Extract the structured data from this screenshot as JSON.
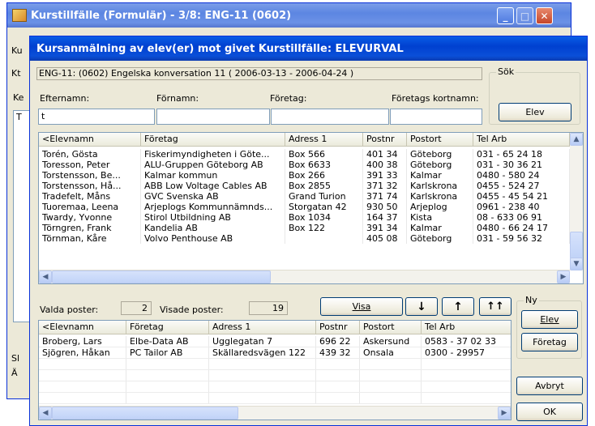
{
  "back_window": {
    "title": "Kurstillfälle (Formulär) - 3/8: ENG-11 (0602)",
    "left_labels": [
      "Ku",
      "Kt",
      "Ke",
      "T",
      "Sl",
      "Ä"
    ]
  },
  "dialog": {
    "title": "Kursanmälning av elev(er) mot givet Kurstillfälle: ELEVURVAL",
    "course_info": "ENG-11: (0602) Engelska konversation 11 ( 2006-03-13 - 2006-04-24 )",
    "sok_label": "Sök",
    "sok_elev_button": "Elev",
    "filter_labels": {
      "efternamn": "Efternamn:",
      "fornamn": "Förnamn:",
      "foretag": "Företag:",
      "kortnamn": "Företags kortnamn:"
    },
    "filter_values": {
      "efternamn": "t",
      "fornamn": "",
      "foretag": "",
      "kortnamn": ""
    },
    "top_grid": {
      "columns": [
        "<Elevnamn",
        "Företag",
        "Adress 1",
        "Postnr",
        "Postort",
        "Tel Arb"
      ],
      "rows": [
        [
          "Torén, Gösta",
          "Fiskerimyndigheten i Göte...",
          "Box 566",
          "401 34",
          "Göteborg",
          "031 - 65 24 18"
        ],
        [
          "Toresson, Peter",
          "ALU-Gruppen Göteborg AB",
          "Box 6633",
          "400 38",
          "Göteborg",
          "031 - 30 36 21"
        ],
        [
          "Torstensson, Be...",
          "Kalmar kommun",
          "Box 266",
          "391 33",
          "Kalmar",
          "0480 - 580 24"
        ],
        [
          "Torstensson, Hå...",
          "ABB Low Voltage Cables AB",
          "Box 2855",
          "371 32",
          "Karlskrona",
          "0455 - 524 27"
        ],
        [
          "Tradefelt, Måns",
          "GVC Svenska AB",
          "Grand Turion",
          "371 74",
          "Karlskrona",
          "0455 - 45 54 21"
        ],
        [
          "Tuoremaa, Leena",
          "Arjeplogs Kommunnämnds...",
          "Storgatan 42",
          "930 50",
          "Arjeplog",
          "0961 - 238 40"
        ],
        [
          "Twardy, Yvonne",
          "Stirol Utbildning AB",
          "Box 1034",
          "164 37",
          "Kista",
          "08 - 633 06 91"
        ],
        [
          "Törngren, Frank",
          "Kandelia AB",
          "Box 122",
          "391 34",
          "Kalmar",
          "0480 - 66 24 17"
        ],
        [
          "Törnman, Kåre",
          "Volvo Penthouse AB",
          "",
          "405 08",
          "Göteborg",
          "031 - 59 56 32"
        ]
      ]
    },
    "status": {
      "valda_label": "Valda poster:",
      "valda_value": "2",
      "visade_label": "Visade poster:",
      "visade_value": "19",
      "visa_button": "Visa",
      "down_arrow": "↓",
      "up_arrow": "↑",
      "double_up": "↑↑"
    },
    "bottom_grid": {
      "columns": [
        "<Elevnamn",
        "Företag",
        "Adress 1",
        "Postnr",
        "Postort",
        "Tel Arb"
      ],
      "rows": [
        [
          "Broberg, Lars",
          "Elbe-Data AB",
          "Ugglegatan 7",
          "696 22",
          "Askersund",
          "0583 - 37 02 33"
        ],
        [
          "Sjögren, Håkan",
          "PC Tailor AB",
          "Skällaredsvägen 122",
          "439 32",
          "Onsala",
          "0300 - 29957"
        ]
      ]
    },
    "ny_label": "Ny",
    "ny_elev_button": "Elev",
    "ny_foretag_button": "Företag",
    "avbryt_button": "Avbryt",
    "ok_button": "OK"
  }
}
